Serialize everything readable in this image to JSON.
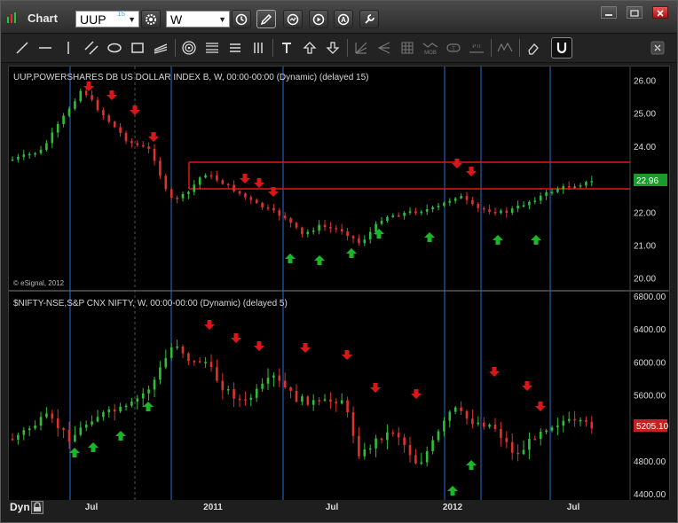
{
  "app": {
    "title": "Chart"
  },
  "toolbar": {
    "symbol": "UUP",
    "symbol_superscript": "15",
    "interval": "W"
  },
  "pane1": {
    "label": "UUP,POWERSHARES DB US DOLLAR INDEX B, W, 00:00-00:00 (Dynamic) (delayed 15)",
    "y_ticks": [
      "26.00",
      "25.00",
      "24.00",
      "23.00",
      "22.00",
      "21.00",
      "20.00"
    ],
    "last_price": "22.96",
    "copyright": "© eSignal, 2012"
  },
  "pane2": {
    "label": "$NIFTY-NSE,S&P CNX NIFTY, W, 00:00-00:00 (Dynamic) (delayed 5)",
    "y_ticks": [
      "6800.00",
      "6400.00",
      "6000.00",
      "5600.00",
      "5200.00",
      "4800.00",
      "4400.00"
    ],
    "last_price": "5205.10"
  },
  "x_axis": {
    "ticks": [
      "Jul",
      "2011",
      "Jul",
      "2012",
      "Jul"
    ]
  },
  "statusbar": {
    "mode": "Dyn"
  },
  "colors": {
    "up": "#2fbf3a",
    "down": "#e03030",
    "up_arrow": "#18b828",
    "down_arrow": "#d81818",
    "level_line": "#e01818",
    "vline": "#2a6fd0",
    "last_price_1_bg": "#1a9a2a",
    "last_price_2_bg": "#c82020"
  }
}
